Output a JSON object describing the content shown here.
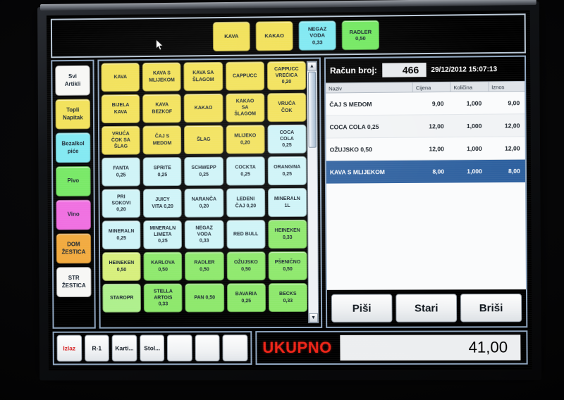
{
  "quickbar": {
    "buttons": [
      {
        "lines": [
          "KAVA"
        ],
        "color": "#f2e157"
      },
      {
        "lines": [
          "KAKAO"
        ],
        "color": "#f2e157"
      },
      {
        "lines": [
          "NEGAZ",
          "VODA",
          "0,33"
        ],
        "color": "#7fe8f2"
      },
      {
        "lines": [
          "RADLER",
          "0,50"
        ],
        "color": "#74e862"
      }
    ]
  },
  "categories": [
    {
      "label_1": "Svi",
      "label_2": "Artikli",
      "color": "#f7f7f5"
    },
    {
      "label_1": "Topli",
      "label_2": "Napitak",
      "color": "#f2e157"
    },
    {
      "label_1": "Bezalkol",
      "label_2": "piće",
      "color": "#7fe8f2"
    },
    {
      "label_1": "Pivo",
      "label_2": "",
      "color": "#74e862"
    },
    {
      "label_1": "Vino",
      "label_2": "",
      "color": "#f06ce0"
    },
    {
      "label_1": "DOM",
      "label_2": "ŽESTICA",
      "color": "#f2a93c"
    },
    {
      "label_1": "STR",
      "label_2": "ŽESTICA",
      "color": "#f7f7f5"
    }
  ],
  "products": [
    {
      "lines": [
        "KAVA"
      ],
      "color": "#f2e157"
    },
    {
      "lines": [
        "KAVA S",
        "MLIJEKOM"
      ],
      "color": "#f2e157"
    },
    {
      "lines": [
        "KAVA SA",
        "ŠLAGOM"
      ],
      "color": "#f2e157"
    },
    {
      "lines": [
        "CAPPUCC"
      ],
      "color": "#f2e157"
    },
    {
      "lines": [
        "CAPPUCC",
        "VREĆICA",
        "0,20"
      ],
      "color": "#f2e157"
    },
    {
      "lines": [
        "BIJELA",
        "KAVA"
      ],
      "color": "#f2e157"
    },
    {
      "lines": [
        "KAVA",
        "BEZKOF"
      ],
      "color": "#f2e157"
    },
    {
      "lines": [
        "KAKAO"
      ],
      "color": "#f2e157"
    },
    {
      "lines": [
        "KAKAO",
        "SA",
        "ŠLAGOM"
      ],
      "color": "#f2e157"
    },
    {
      "lines": [
        "VRUĆA",
        "ČOK"
      ],
      "color": "#f2e157"
    },
    {
      "lines": [
        "VRUĆA",
        "ČOK SA",
        "ŠLAG"
      ],
      "color": "#f2e157"
    },
    {
      "lines": [
        "ČAJ S",
        "MEDOM"
      ],
      "color": "#f2e157"
    },
    {
      "lines": [
        "ŠLAG"
      ],
      "color": "#f2e157"
    },
    {
      "lines": [
        "MLIJEKO",
        "0,20"
      ],
      "color": "#f2e157"
    },
    {
      "lines": [
        "COCA",
        "COLA",
        "0,25"
      ],
      "color": "#cdf3f7"
    },
    {
      "lines": [
        "FANTA",
        "0,25"
      ],
      "color": "#cdf3f7"
    },
    {
      "lines": [
        "SPRITE",
        "0,25"
      ],
      "color": "#cdf3f7"
    },
    {
      "lines": [
        "SCHWEPP",
        "0,25"
      ],
      "color": "#cdf3f7"
    },
    {
      "lines": [
        "COCKTA",
        "0,25"
      ],
      "color": "#cdf3f7"
    },
    {
      "lines": [
        "ORANGINA",
        "0,25"
      ],
      "color": "#cdf3f7"
    },
    {
      "lines": [
        "PRI",
        "SOKOVI",
        "0,20"
      ],
      "color": "#cdf3f7"
    },
    {
      "lines": [
        "JUICY",
        "VITA 0,20"
      ],
      "color": "#cdf3f7"
    },
    {
      "lines": [
        "NARANČA",
        "0,20"
      ],
      "color": "#cdf3f7"
    },
    {
      "lines": [
        "LEDENI",
        "ČAJ 0,20"
      ],
      "color": "#cdf3f7"
    },
    {
      "lines": [
        "MINERALN",
        "1L"
      ],
      "color": "#cdf3f7"
    },
    {
      "lines": [
        "MINERALN",
        "0,25"
      ],
      "color": "#cdf3f7"
    },
    {
      "lines": [
        "MINERALN",
        "LIMETA",
        "0,25"
      ],
      "color": "#cdf3f7"
    },
    {
      "lines": [
        "NEGAZ",
        "VODA",
        "0,33"
      ],
      "color": "#cdf3f7"
    },
    {
      "lines": [
        "RED BULL"
      ],
      "color": "#cdf3f7"
    },
    {
      "lines": [
        "HEINEKEN",
        "0,33"
      ],
      "color": "#8ce86a"
    },
    {
      "lines": [
        "HEINEKEN",
        "0,50"
      ],
      "color": "#d6ef7a"
    },
    {
      "lines": [
        "KARLOVA",
        "0,50"
      ],
      "color": "#8ce86a"
    },
    {
      "lines": [
        "RADLER",
        "0,50"
      ],
      "color": "#8ce86a"
    },
    {
      "lines": [
        "OŽUJSKO",
        "0,50"
      ],
      "color": "#8ce86a"
    },
    {
      "lines": [
        "PŠENIČNO",
        "0,50"
      ],
      "color": "#8ce86a"
    },
    {
      "lines": [
        "STAROPR"
      ],
      "color": "#aef08c"
    },
    {
      "lines": [
        "STELLA",
        "ARTOIS",
        "0,33"
      ],
      "color": "#8ce86a"
    },
    {
      "lines": [
        "PAN 0,50"
      ],
      "color": "#8ce86a"
    },
    {
      "lines": [
        "BAVARIA",
        "0,25"
      ],
      "color": "#8ce86a"
    },
    {
      "lines": [
        "BECKS",
        "0,33"
      ],
      "color": "#8ce86a"
    }
  ],
  "scrollbar": {
    "up": "▲",
    "down": "▼"
  },
  "receipt": {
    "label": "Račun broj:",
    "number": "466",
    "datetime": "29/12/2012 15:07:13",
    "columns": [
      "Naziv",
      "Cijena",
      "Količina",
      "Iznos"
    ],
    "rows": [
      {
        "naziv": "ČAJ S MEDOM",
        "cijena": "9,00",
        "kolicina": "1,000",
        "iznos": "9,00",
        "selected": false
      },
      {
        "naziv": "COCA COLA 0,25",
        "cijena": "12,00",
        "kolicina": "1,000",
        "iznos": "12,00",
        "selected": false
      },
      {
        "naziv": "OŽUJSKO 0,50",
        "cijena": "12,00",
        "kolicina": "1,000",
        "iznos": "12,00",
        "selected": false
      },
      {
        "naziv": "KAVA S MLIJEKOM",
        "cijena": "8,00",
        "kolicina": "1,000",
        "iznos": "8,00",
        "selected": true
      }
    ],
    "actions": [
      "Piši",
      "Stari",
      "Briši"
    ]
  },
  "total": {
    "label": "UKUPNO",
    "value": "41,00",
    "color": "#ef2417"
  },
  "function_bar": {
    "buttons": [
      "Izlaz",
      "R-1",
      "Karti...",
      "Stol...",
      "",
      "",
      ""
    ]
  }
}
